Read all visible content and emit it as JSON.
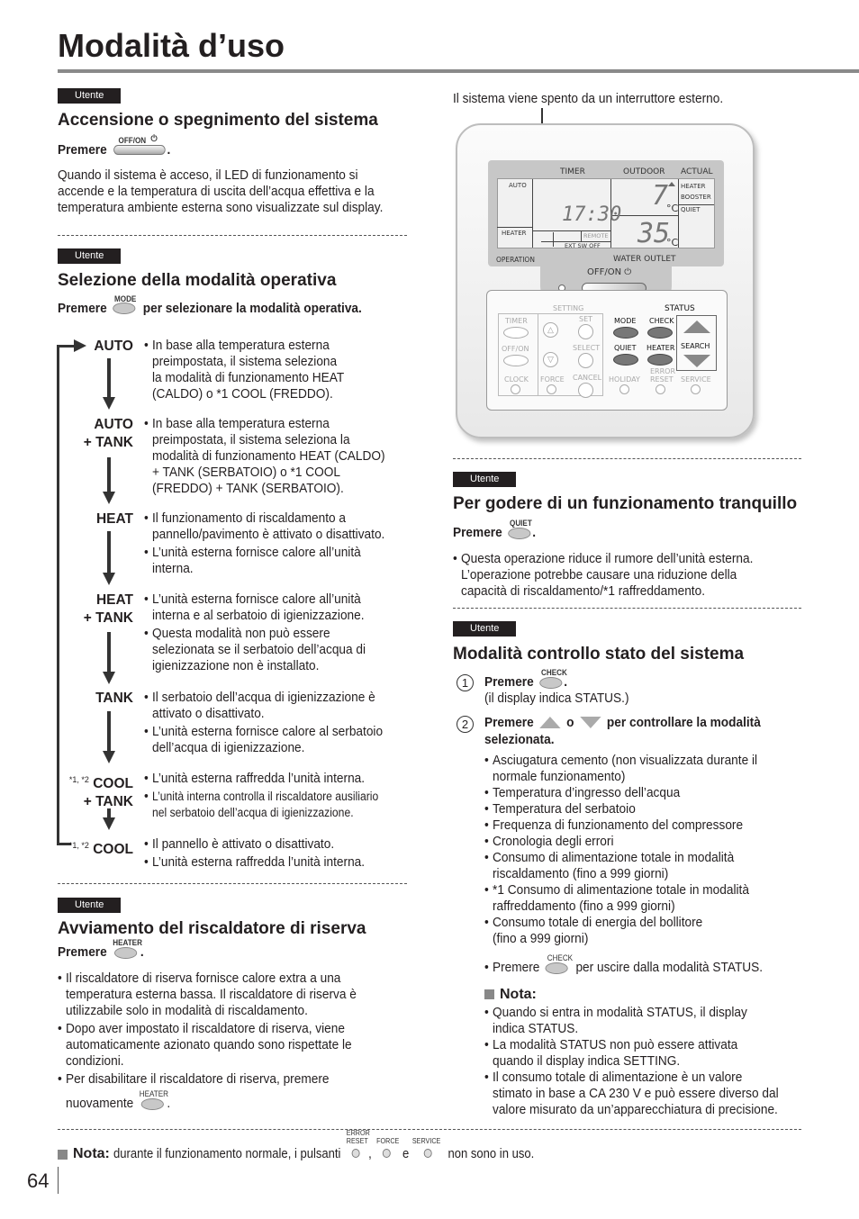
{
  "page": {
    "title": "Modalità d’uso",
    "page_number": "64",
    "tag_label": "Utente"
  },
  "buttons": {
    "offon": "OFF/ON",
    "mode": "MODE",
    "quiet": "QUIET",
    "check": "CHECK",
    "heater": "HEATER",
    "error_reset_1": "ERROR",
    "error_reset_2": "RESET",
    "force": "FORCE",
    "service": "SERVICE"
  },
  "section_power": {
    "heading": "Accensione o spegnimento del sistema",
    "press": "Premere",
    "body": [
      "Quando il sistema è acceso, il LED di funzionamento si",
      "accende e la temperatura di uscita dell’acqua effettiva e la",
      "temperatura ambiente esterna sono visualizzate sul display."
    ]
  },
  "section_mode": {
    "heading": "Selezione della modalità operativa",
    "press": "Premere",
    "press_suffix": "per selezionare la modalità operativa.",
    "modes": [
      {
        "label1": "AUTO",
        "label2": "",
        "prefix": "",
        "bullets": [
          [
            "In base alla temperatura esterna",
            "preimpostata, il sistema seleziona",
            "la modalità di funzionamento HEAT",
            "(CALDO) o *1 COOL (FREDDO)."
          ]
        ]
      },
      {
        "label1": "AUTO",
        "label2": "+ TANK",
        "prefix": "",
        "bullets": [
          [
            "In base alla temperatura esterna",
            "preimpostata, il sistema seleziona la",
            "modalità di funzionamento HEAT (CALDO)",
            "+ TANK (SERBATOIO) o *1 COOL",
            "(FREDDO) + TANK (SERBATOIO)."
          ]
        ]
      },
      {
        "label1": "HEAT",
        "label2": "",
        "prefix": "",
        "bullets": [
          [
            "Il funzionamento di riscaldamento a",
            "pannello/pavimento è attivato o disattivato."
          ],
          [
            "L’unità esterna fornisce calore all’unità",
            "interna."
          ]
        ]
      },
      {
        "label1": "HEAT",
        "label2": "+ TANK",
        "prefix": "",
        "bullets": [
          [
            "L’unità esterna fornisce calore all’unità",
            "interna e al serbatoio di igienizzazione."
          ],
          [
            "Questa modalità non può essere",
            "selezionata se il serbatoio dell’acqua di",
            "igienizzazione non è installato."
          ]
        ]
      },
      {
        "label1": "TANK",
        "label2": "",
        "prefix": "",
        "bullets": [
          [
            "Il serbatoio dell’acqua di igienizzazione è",
            "attivato o disattivato."
          ],
          [
            "L’unità esterna fornisce calore al serbatoio",
            "dell’acqua di igienizzazione."
          ]
        ]
      },
      {
        "label1": "COOL",
        "label2": "+ TANK",
        "prefix": "*1, *2",
        "bullets": [
          [
            "L’unità esterna raffredda l’unità interna."
          ],
          [
            "L’unità interna controlla il riscaldatore ausiliario",
            "nel serbatoio dell’acqua di igienizzazione."
          ]
        ]
      },
      {
        "label1": "COOL",
        "label2": "",
        "prefix": "*1, *2",
        "bullets": [
          [
            "Il pannello è attivato o disattivato."
          ],
          [
            "L’unità esterna raffredda l’unità interna."
          ]
        ]
      }
    ]
  },
  "section_heater": {
    "heading": "Avviamento del riscaldatore di riserva",
    "press": "Premere",
    "bullets": [
      [
        "Il riscaldatore di riserva fornisce calore extra a una",
        "temperatura esterna bassa. Il riscaldatore di riserva è",
        "utilizzabile solo in modalità di riscaldamento."
      ],
      [
        "Dopo aver impostato il riscaldatore di riserva, viene",
        "automaticamente azionato quando sono rispettate le",
        "condizioni."
      ],
      [
        "Per disabilitare il riscaldatore di riserva, premere"
      ]
    ],
    "last_line": "nuovamente"
  },
  "remote": {
    "caption": "Il sistema viene spento da un interruttore esterno.",
    "lcd": {
      "timer": "TIMER",
      "outdoor": "OUTDOOR",
      "actual": "ACTUAL",
      "auto": "AUTO",
      "heater": "HEATER",
      "remote": "REMOTE",
      "ext_sw_off": "EXT SW OFF",
      "time": "17:30",
      "outdoor_temp": "7",
      "water_temp": "35",
      "unit": "°C",
      "heater_r": "HEATER",
      "booster": "BOOSTER",
      "quiet": "QUIET",
      "operation": "OPERATION",
      "water_outlet": "WATER OUTLET",
      "offon": "OFF/ON"
    },
    "keys": {
      "setting": "SETTING",
      "status": "STATUS",
      "timer": "TIMER",
      "offon": "OFF/ON",
      "clock": "CLOCK",
      "set": "SET",
      "select": "SELECT",
      "force": "FORCE",
      "cancel": "CANCEL",
      "mode": "MODE",
      "check": "CHECK",
      "quiet": "QUIET",
      "heater": "HEATER",
      "search": "SEARCH",
      "holiday": "HOLIDAY",
      "error": "ERROR",
      "reset": "RESET",
      "service": "SERVICE"
    }
  },
  "section_quiet": {
    "heading": "Per godere di un funzionamento tranquillo",
    "press": "Premere",
    "bullet": [
      "Questa operazione riduce il rumore dell’unità esterna.",
      "L’operazione potrebbe causare una riduzione della",
      "capacità di riscaldamento/*1 raffreddamento."
    ]
  },
  "section_status": {
    "heading": "Modalità controllo stato del sistema",
    "step1_num": "1",
    "step1_press": "Premere",
    "step1_note": "(il display indica STATUS.)",
    "step2_num": "2",
    "step2_press": "Premere",
    "step2_or": "o",
    "step2_text": "per controllare la modalità",
    "step2_text2": "selezionata.",
    "items": [
      [
        "Asciugatura cemento (non visualizzata durante il",
        "normale funzionamento)"
      ],
      [
        "Temperatura d’ingresso dell’acqua"
      ],
      [
        "Temperatura del serbatoio"
      ],
      [
        "Frequenza di funzionamento del compressore"
      ],
      [
        "Cronologia degli errori"
      ],
      [
        "Consumo di alimentazione totale in modalità",
        "riscaldamento (fino a 999 giorni)"
      ],
      [
        "*1 Consumo di alimentazione totale in modalità",
        "raffreddamento (fino a 999 giorni)"
      ],
      [
        "Consumo totale di energia del bollitore",
        "(fino a 999 giorni)"
      ]
    ],
    "exit_press": "Premere",
    "exit_text": "per uscire dalla modalità STATUS.",
    "nota_label": "Nota:",
    "nota_items": [
      [
        "Quando si entra in modalità STATUS, il display",
        "indica STATUS."
      ],
      [
        "La modalità STATUS non può essere attivata",
        "quando il display indica SETTING."
      ],
      [
        "Il consumo totale di alimentazione è un valore",
        "stimato in base a CA 230 V e può essere diverso dal",
        "valore misurato da un’apparecchiatura di precisione."
      ]
    ]
  },
  "footer_note": {
    "label": "Nota:",
    "text1": "durante il funzionamento normale, i pulsanti",
    "comma": ",",
    "and": "e",
    "text2": "non sono in uso."
  }
}
